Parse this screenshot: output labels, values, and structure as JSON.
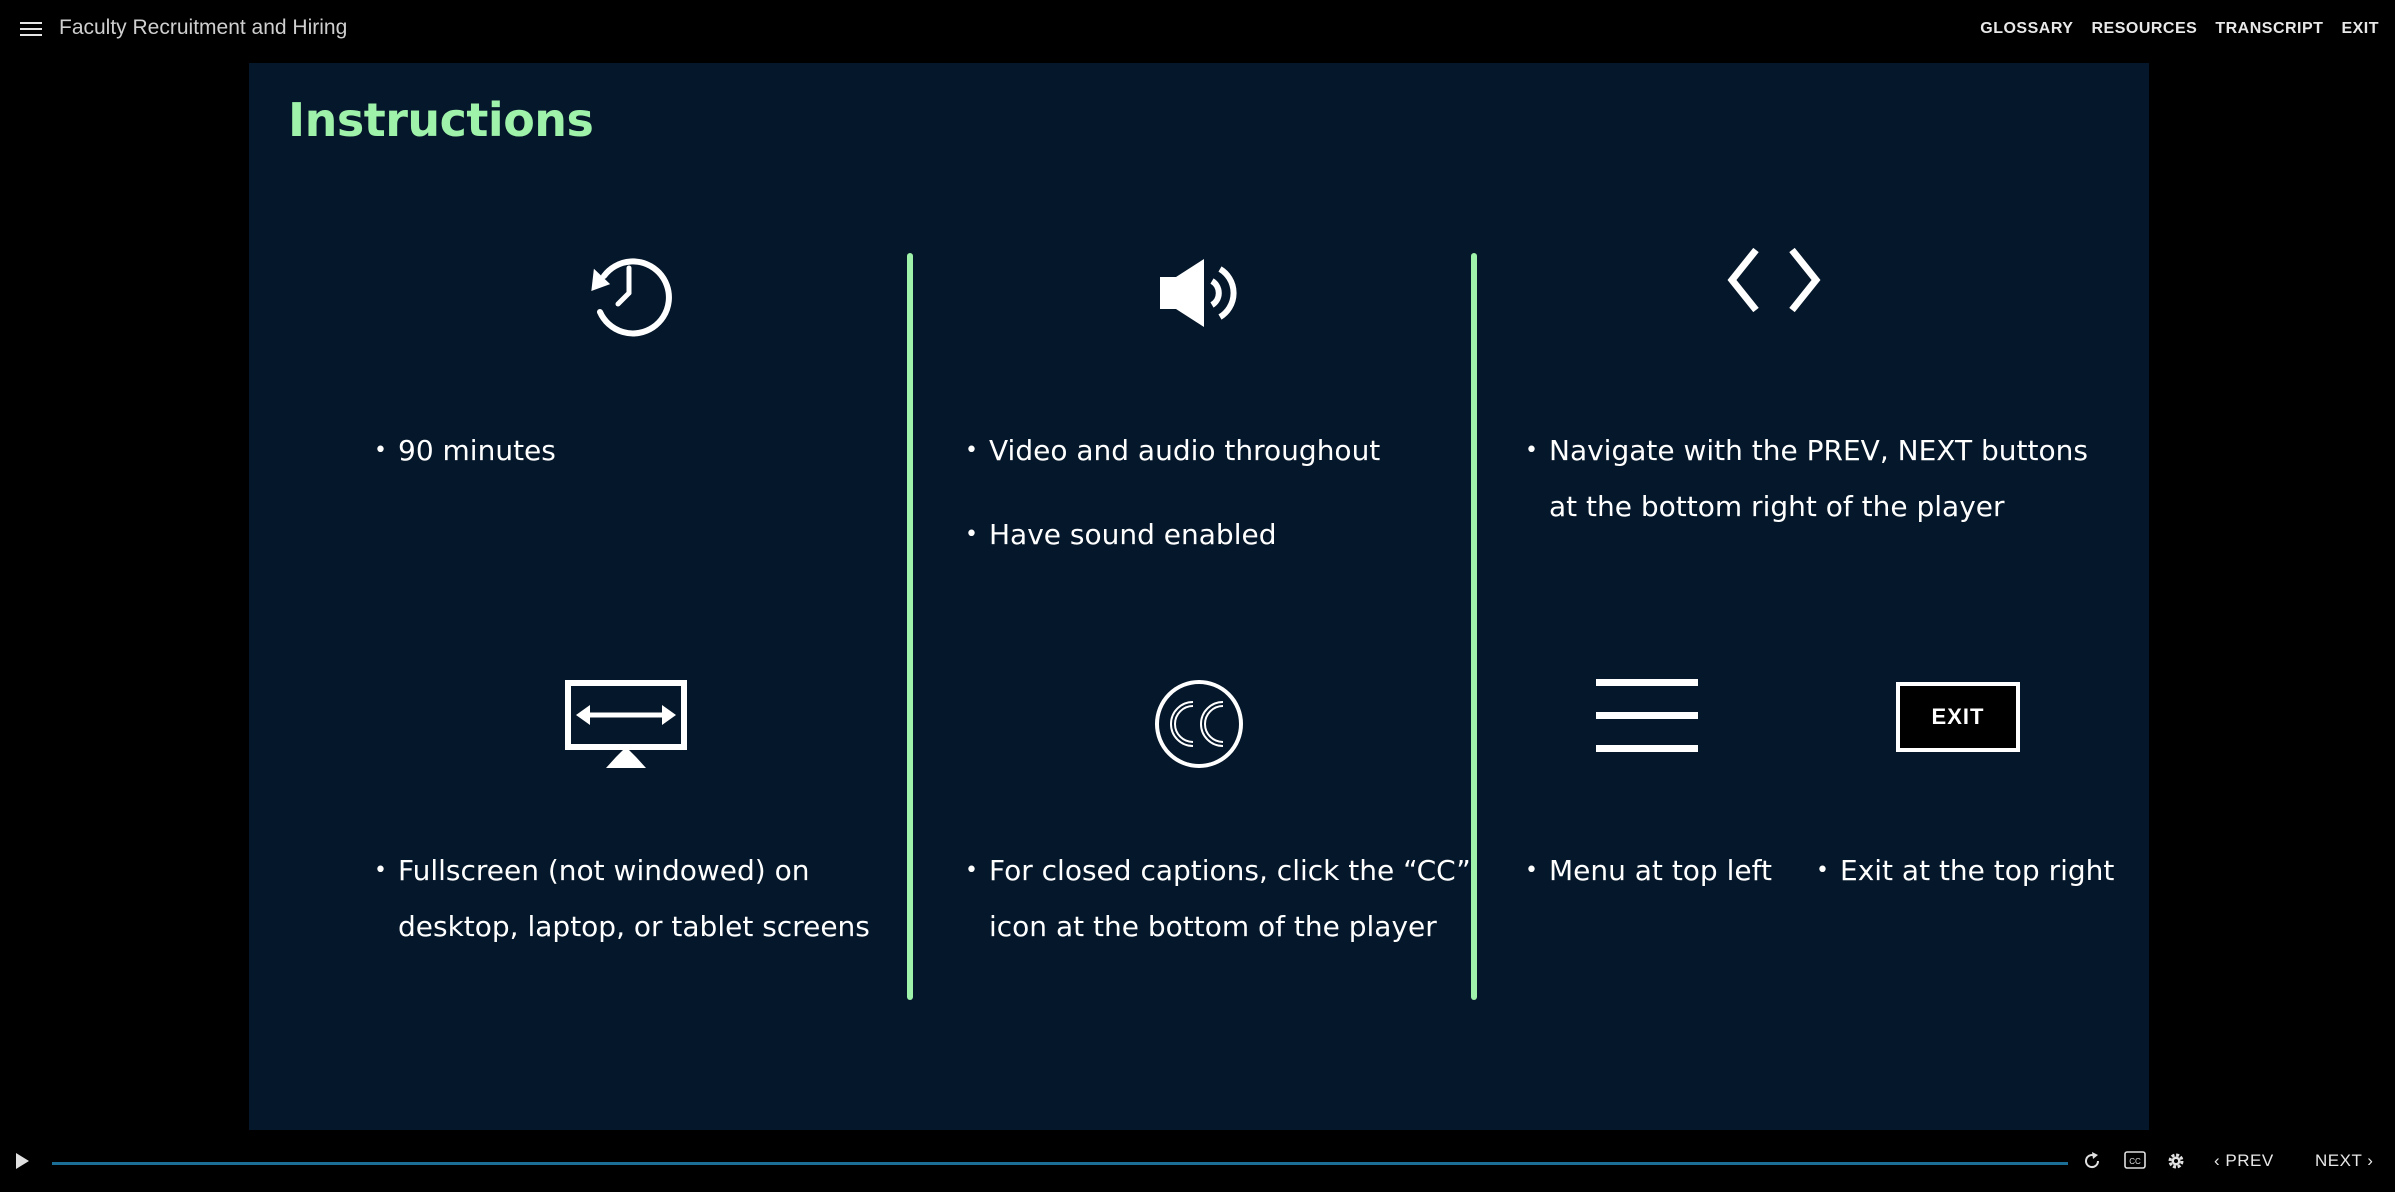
{
  "header": {
    "title": "Faculty Recruitment and Hiring",
    "links": [
      "GLOSSARY",
      "RESOURCES",
      "TRANSCRIPT",
      "EXIT"
    ]
  },
  "slide": {
    "title": "Instructions",
    "accent_color": "#9ef2a9",
    "background": "#05172a",
    "sections": {
      "duration": {
        "icon": "clock-history-icon",
        "bullets": [
          "90 minutes"
        ]
      },
      "audio": {
        "icon": "speaker-icon",
        "bullets": [
          "Video and audio throughout",
          "Have sound enabled"
        ]
      },
      "navigation": {
        "icon": "code-arrows-icon",
        "bullets": [
          "Navigate with the PREV, NEXT buttons",
          "at the bottom right of the player"
        ]
      },
      "fullscreen": {
        "icon": "monitor-icon",
        "bullets": [
          "Fullscreen (not windowed) on",
          "desktop, laptop, or tablet screens"
        ]
      },
      "captions": {
        "icon": "closed-captions-icon",
        "bullets": [
          "For closed captions, click the “CC”",
          "icon at the bottom of the player"
        ]
      },
      "menu": {
        "icon": "hamburger-menu-icon",
        "bullets": [
          "Menu at top left"
        ]
      },
      "exit": {
        "icon": "exit-icon",
        "icon_label": "EXIT",
        "bullets": [
          "Exit at the top right"
        ]
      }
    }
  },
  "player": {
    "progress": 0,
    "prev_label": "PREV",
    "next_label": "NEXT"
  }
}
